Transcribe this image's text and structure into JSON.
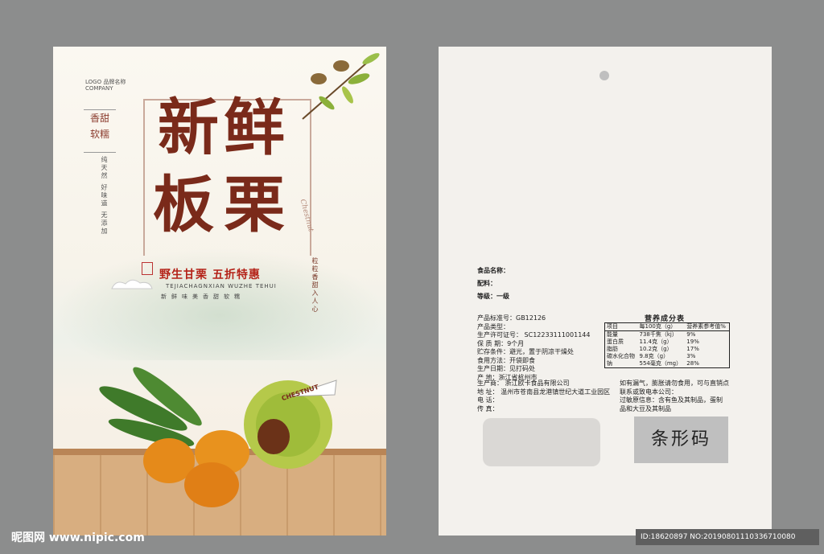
{
  "front": {
    "logo_line1": "LOGO 品牌名称",
    "logo_line2": "COMPANY",
    "tag_line1": "香甜",
    "tag_line2": "软糯",
    "vertical_small": "纯天然 好味道 无添加",
    "title_char1": "新",
    "title_char2": "鲜",
    "title_char3": "板",
    "title_char4": "栗",
    "chestnut_word": "Chestnut",
    "slogan": "野生甘栗 五折特惠",
    "pinyin": "TEJIACHAGNXIAN WUZHE TEHUI",
    "small_line": "新鲜味美香甜软糯",
    "vertical_slogan": "粒粒香甜入人心",
    "ribbon_label": "CHESTNUT"
  },
  "back": {
    "name_label": "食品名称：",
    "ingredients_label": "配料：",
    "grade": "等级：一级",
    "info_lines": [
      "产品标准号：GB12126",
      "产品类型：",
      "生产许可证号：  SC12233111001144",
      "保  质  期：9个月",
      "贮存条件：避光，置于阴凉干燥处",
      "食用方法：开袋即食",
      "生产日期：见打码处",
      "产      地：浙江省杭州市"
    ],
    "maker_lines": [
      "生产商：  浙江欧卡食品有限公司",
      "地    址：  温州市苍南县龙港镇世纪大道工业园区",
      "电    话：",
      "传    真："
    ],
    "nutrition_title": "营养成分表",
    "nutrition_headers": [
      "项目",
      "每100克（g）",
      "营养素参考值%"
    ],
    "nutrition_rows": [
      [
        "能量",
        "738千焦（kj）",
        "9%"
      ],
      [
        "蛋白质",
        "11.4克（g）",
        "19%"
      ],
      [
        "脂肪",
        "10.2克（g）",
        "17%"
      ],
      [
        "碳水化合物",
        "9.8克（g）",
        "3%"
      ],
      [
        "钠",
        "554毫克（mg）",
        "28%"
      ]
    ],
    "notice_lines": [
      "如有漏气，膨胀请勿食用，可与直销点",
      "联系或致电本公司：",
      "过敏原信息：含有鱼及其制品，蛋制",
      "品和大豆及其制品"
    ],
    "barcode_label": "条形码"
  },
  "watermark": {
    "left": "昵图网 www.nipic.com",
    "right": "ID:18620897 NO:20190801110336710080"
  }
}
